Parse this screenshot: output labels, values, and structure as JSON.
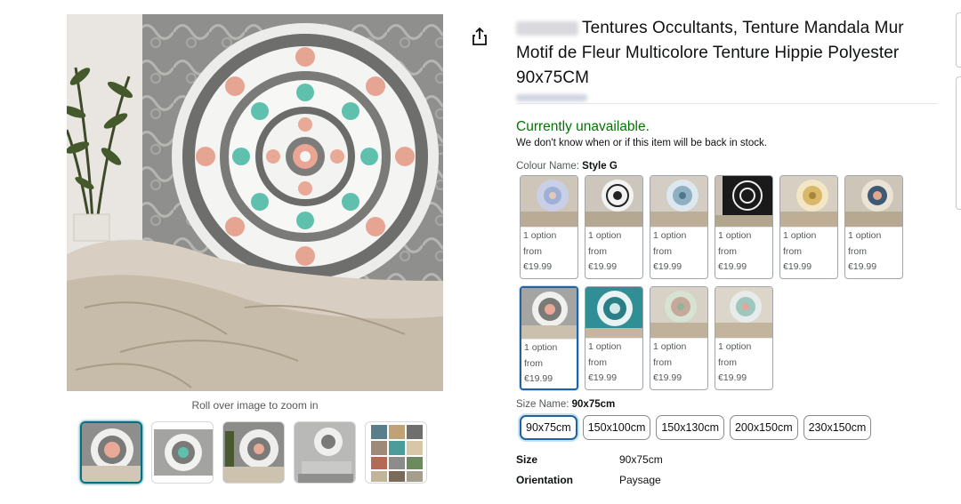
{
  "product": {
    "title": "Tentures Occultants, Tenture Mandala Mur Motif de Fleur Multicolore Tenture Hippie Polyester 90x75CM",
    "zoom_hint": "Roll over image to zoom in"
  },
  "availability": {
    "status": "Currently unavailable.",
    "note": "We don't know when or if this item will be back in stock."
  },
  "colour": {
    "label": "Colour Name:",
    "selected": "Style G",
    "options": [
      {
        "line1": "1 option",
        "line2": "from",
        "price": "€19.99"
      },
      {
        "line1": "1 option",
        "line2": "from",
        "price": "€19.99"
      },
      {
        "line1": "1 option",
        "line2": "from",
        "price": "€19.99"
      },
      {
        "line1": "1 option",
        "line2": "from",
        "price": "€19.99"
      },
      {
        "line1": "1 option",
        "line2": "from",
        "price": "€19.99"
      },
      {
        "line1": "1 option",
        "line2": "from",
        "price": "€19.99"
      },
      {
        "line1": "1 option",
        "line2": "from",
        "price": "€19.99"
      },
      {
        "line1": "1 option",
        "line2": "from",
        "price": "€19.99"
      },
      {
        "line1": "1 option",
        "line2": "from",
        "price": "€19.99"
      },
      {
        "line1": "1 option",
        "line2": "from",
        "price": "€19.99"
      }
    ]
  },
  "size": {
    "label": "Size Name:",
    "selected": "90x75cm",
    "options": [
      "90x75cm",
      "150x100cm",
      "150x130cm",
      "200x150cm",
      "230x150cm"
    ]
  },
  "specs": [
    {
      "key": "Size",
      "value": "90x75cm"
    },
    {
      "key": "Orientation",
      "value": "Paysage"
    }
  ],
  "colors": {
    "available_green": "#007600",
    "selected_blue": "#2162a1",
    "thumb_selected": "#007185"
  },
  "icons": {
    "share": "share-icon"
  }
}
